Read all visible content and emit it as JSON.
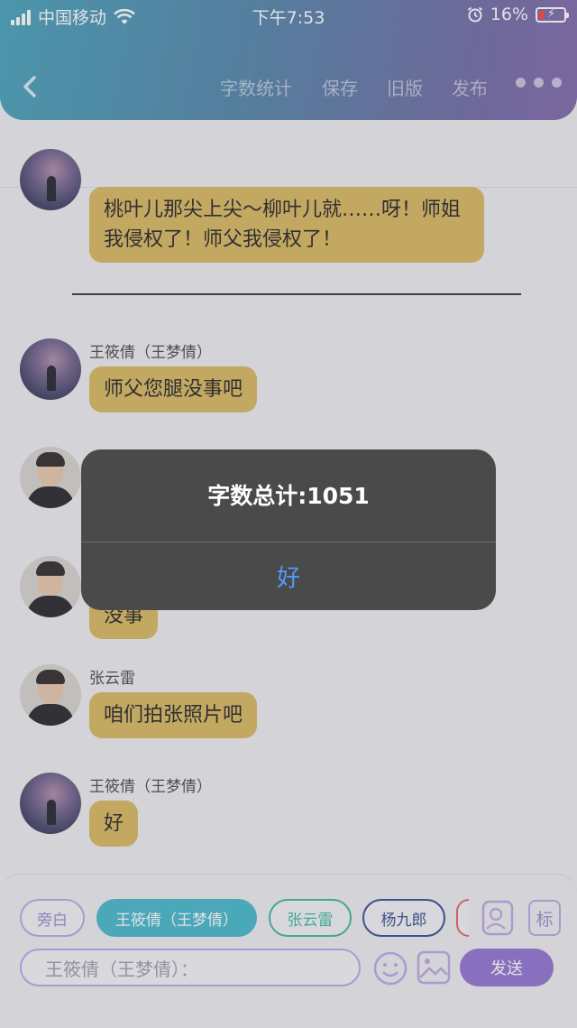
{
  "status_bar": {
    "carrier": "中国移动",
    "time": "下午7:53",
    "battery_percent": "16%"
  },
  "toolbar": {
    "word_count_label": "字数统计",
    "save_label": "保存",
    "old_version_label": "旧版",
    "publish_label": "发布"
  },
  "messages": [
    {
      "speaker": "",
      "text": "桃叶儿那尖上尖～柳叶儿就……呀！师姐我侵权了！师父我侵权了！"
    },
    {
      "speaker": "王筱倩（王梦倩）",
      "text": "师父您腿没事吧"
    },
    {
      "speaker": "",
      "text": "没事"
    },
    {
      "speaker": "张云雷",
      "text": "咱们拍张照片吧"
    },
    {
      "speaker": "王筱倩（王梦倩）",
      "text": "好"
    }
  ],
  "roles": [
    {
      "label": "旁白",
      "color": "#b9a6e0"
    },
    {
      "label": "王筱倩（王梦倩）",
      "color": "#3fb6c8"
    },
    {
      "label": "张云雷",
      "color": "#39b59b"
    },
    {
      "label": "杨九郎",
      "color": "#2d4a8a"
    }
  ],
  "input": {
    "placeholder": "王筱倩（王梦倩）：",
    "send_label": "发送"
  },
  "side_icons": {
    "mark_label": "标"
  },
  "alert": {
    "title": "字数总计:1051",
    "ok_label": "好"
  },
  "colors": {
    "bubble": "#d9b659",
    "send_button": "#8f6fd0",
    "alert_button_text": "#4f9cf8"
  }
}
